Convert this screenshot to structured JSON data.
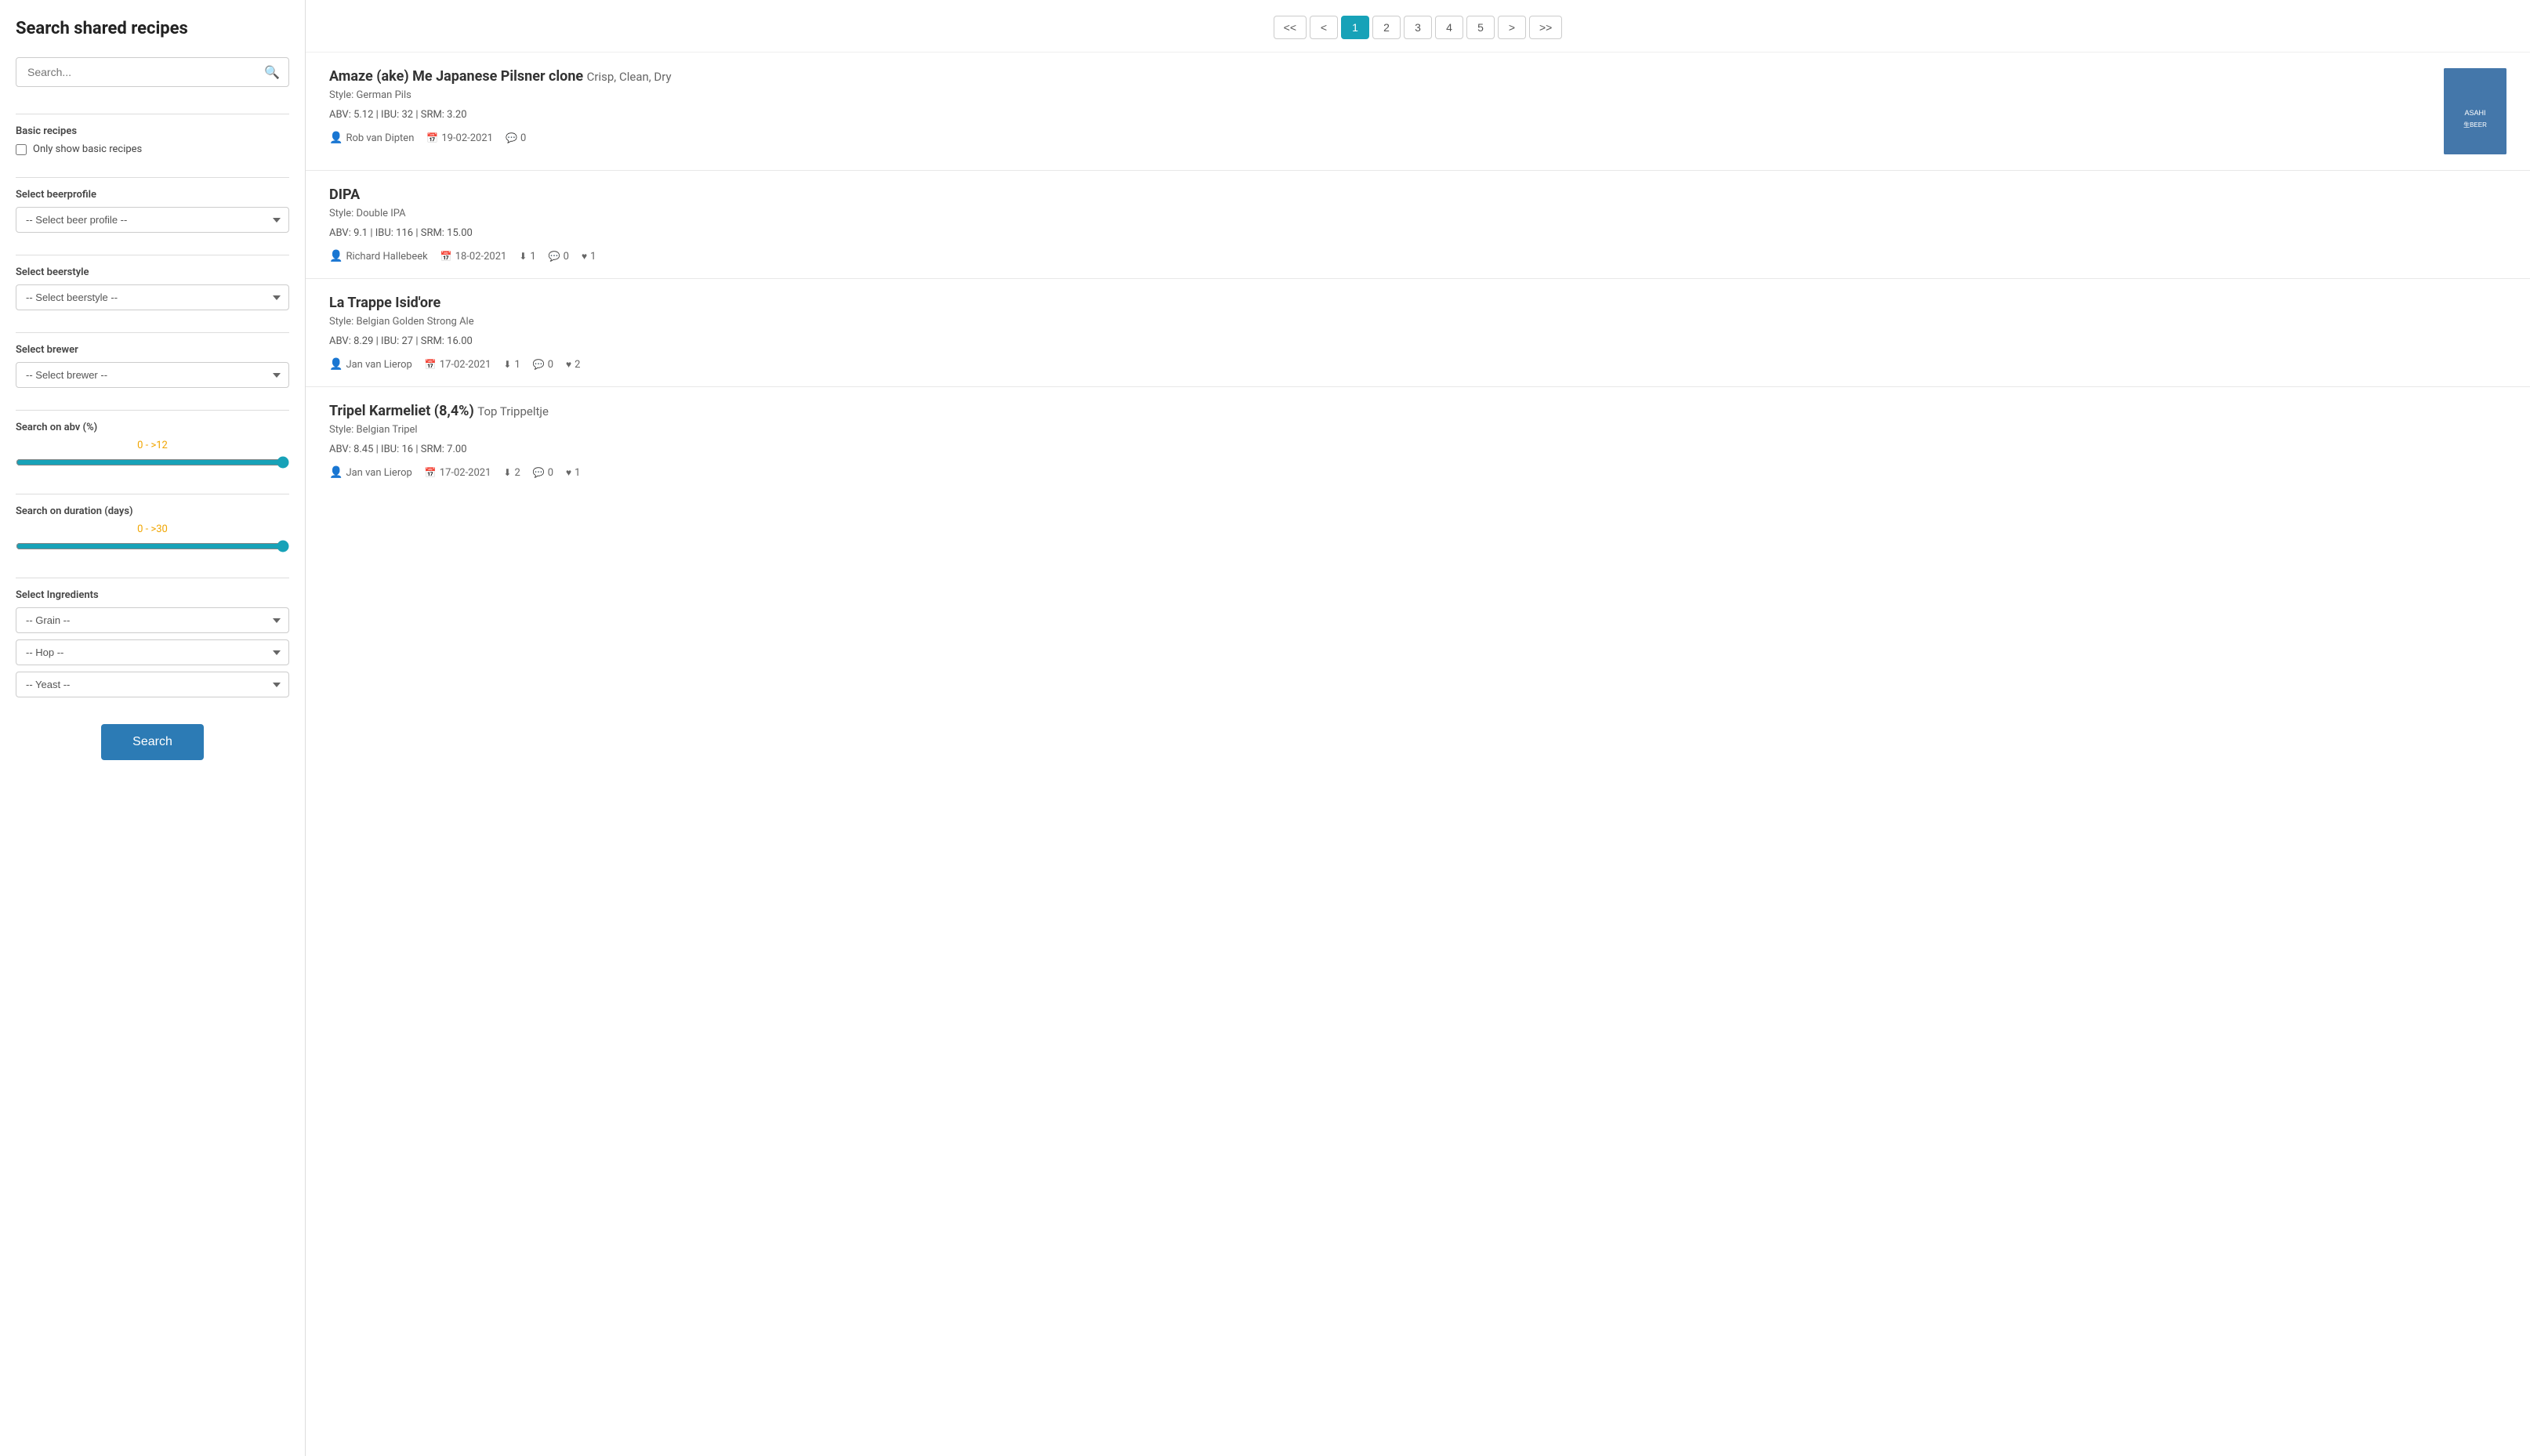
{
  "sidebar": {
    "title": "Search shared recipes",
    "search_placeholder": "Search...",
    "basic_recipes": {
      "label": "Basic recipes",
      "checkbox_label": "Only show basic recipes"
    },
    "beer_profile": {
      "label": "Select beerprofile",
      "placeholder": "-- Select beer profile --"
    },
    "beer_style": {
      "label": "Select beerstyle",
      "placeholder": "-- Select beerstyle --"
    },
    "brewer": {
      "label": "Select brewer",
      "placeholder": "-- Select brewer --"
    },
    "abv": {
      "label": "Search on abv (%)",
      "range_display": "0 - >12",
      "min": 0,
      "max": 12
    },
    "duration": {
      "label": "Search on duration (days)",
      "range_display": "0 - >30",
      "min": 0,
      "max": 30
    },
    "ingredients": {
      "label": "Select Ingredients",
      "grain_placeholder": "-- Grain --",
      "hop_placeholder": "-- Hop --",
      "yeast_placeholder": "-- Yeast --"
    },
    "search_button": "Search"
  },
  "pagination": {
    "first": "<<",
    "prev": "<",
    "pages": [
      "1",
      "2",
      "3",
      "4",
      "5"
    ],
    "active_page": "1",
    "next": ">",
    "last": ">>"
  },
  "recipes": [
    {
      "id": "recipe-1",
      "title": "Amaze (ake) Me Japanese Pilsner clone",
      "subtitle": "Crisp, Clean, Dry",
      "style": "German Pils",
      "abv": "5.12",
      "ibu": "32",
      "srm": "3.20",
      "author": "Rob van Dipten",
      "date": "19-02-2021",
      "comments": "0",
      "downloads": null,
      "likes": null,
      "has_image": true,
      "image_bg": "#b0c8e0"
    },
    {
      "id": "recipe-2",
      "title": "DIPA",
      "subtitle": "",
      "style": "Double IPA",
      "abv": "9.1",
      "ibu": "116",
      "srm": "15.00",
      "author": "Richard Hallebeek",
      "date": "18-02-2021",
      "downloads": "1",
      "comments": "0",
      "likes": "1",
      "has_image": false
    },
    {
      "id": "recipe-3",
      "title": "La Trappe Isid'ore",
      "subtitle": "",
      "style": "Belgian Golden Strong Ale",
      "abv": "8.29",
      "ibu": "27",
      "srm": "16.00",
      "author": "Jan van Lierop",
      "date": "17-02-2021",
      "downloads": "1",
      "comments": "0",
      "likes": "2",
      "has_image": false
    },
    {
      "id": "recipe-4",
      "title": "Tripel Karmeliet (8,4%)",
      "subtitle": "Top Trippeltje",
      "style": "Belgian Tripel",
      "abv": "8.45",
      "ibu": "16",
      "srm": "7.00",
      "author": "Jan van Lierop",
      "date": "17-02-2021",
      "downloads": "2",
      "comments": "0",
      "likes": "1",
      "has_image": false
    }
  ]
}
